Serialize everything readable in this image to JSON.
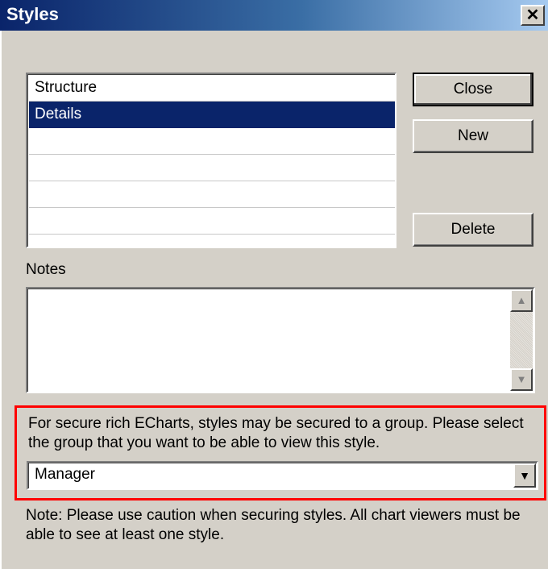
{
  "window": {
    "title": "Styles",
    "close_glyph": "✕"
  },
  "styles_list": {
    "items": [
      "Structure",
      "Details",
      "",
      "",
      "",
      ""
    ],
    "selected_index": 1
  },
  "buttons": {
    "close_label": "Close",
    "new_label": "New",
    "delete_label": "Delete"
  },
  "notes": {
    "label": "Notes",
    "value": "",
    "scroll_up_icon": "arrow-up-icon",
    "scroll_down_icon": "arrow-down-icon"
  },
  "group": {
    "description": "For secure rich ECharts, styles may be secured to a group. Please select the group that you want to be able to view this style.",
    "selected_value": "Manager",
    "highlight_color": "#ff0000"
  },
  "footer_note": "Note: Please use caution when securing styles. All chart viewers must be able to see at least one style.",
  "colors": {
    "selection": "#0a246a",
    "dialog_bg": "#d4d0c8"
  }
}
